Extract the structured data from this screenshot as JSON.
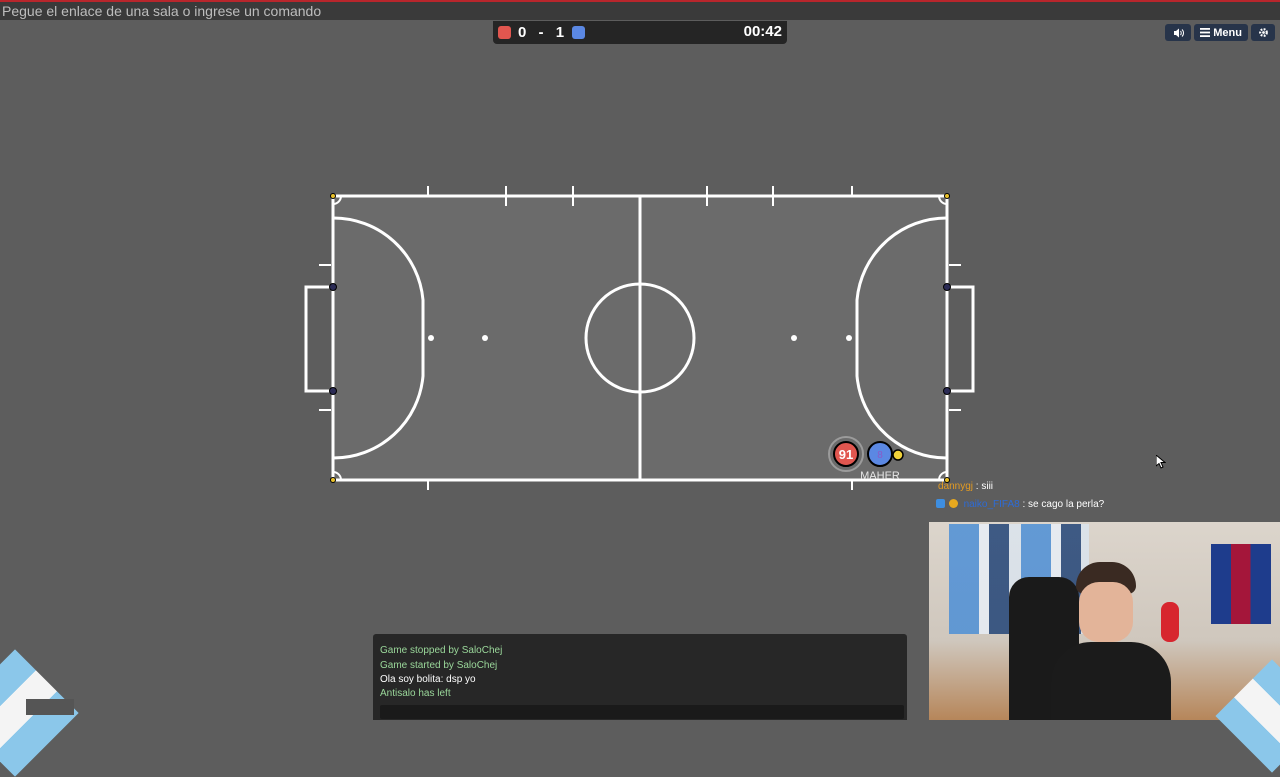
{
  "command_bar": {
    "placeholder": "Pegue el enlace de una sala o ingrese un comando"
  },
  "scoreboard": {
    "red_score": "0",
    "separator": "-",
    "blue_score": "1",
    "timer": "00:42",
    "red_color": "#e1564f",
    "blue_color": "#5b88e3"
  },
  "toolbar": {
    "sound_icon": "speaker-icon",
    "menu_label": "Menu",
    "settings_icon": "gear-icon"
  },
  "players": {
    "red_player_number": "91",
    "blue_player_number": "8",
    "blue_player_nick": "MAHER"
  },
  "stream_chat": [
    {
      "user": "dannygj",
      "text": " : siii",
      "user_color": "#e39b22"
    },
    {
      "user": "naiko_FIFA8",
      "text": " : se cago la perla?",
      "user_color": "#2d6bd6"
    }
  ],
  "game_chat": {
    "lines": [
      {
        "text": "Game stopped by SaloChej",
        "color": "#9ad79a"
      },
      {
        "text": "Game started by SaloChej",
        "color": "#9ad79a"
      },
      {
        "text": "Ola soy bolita: dsp yo",
        "color": "#ffffff"
      },
      {
        "text": "Antisalo has left",
        "color": "#9ad79a"
      }
    ]
  }
}
